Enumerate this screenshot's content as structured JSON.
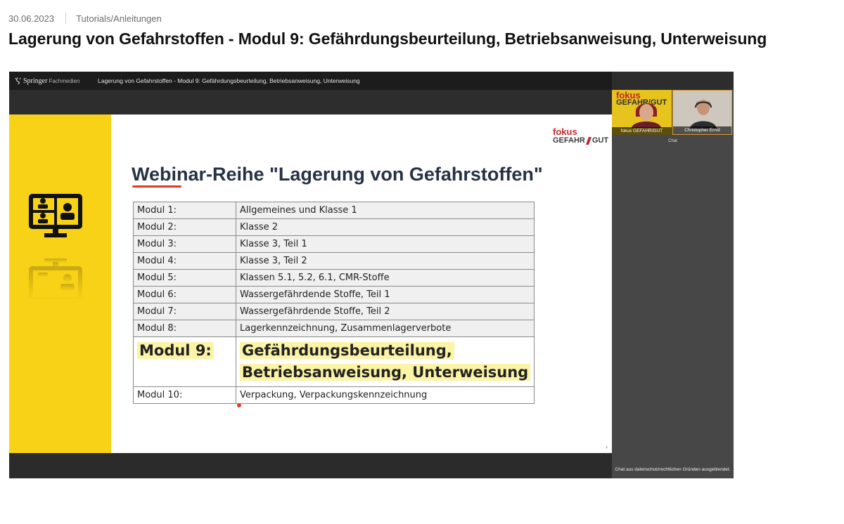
{
  "meta": {
    "date": "30.06.2023",
    "category": "Tutorials/Anleitungen"
  },
  "page_title": "Lagerung von Gefahrstoffen - Modul 9: Gefährdungsbeurteilung, Betriebsanweisung, Unterweisung",
  "player": {
    "brand": {
      "name": "Springer",
      "suffix": "Fachmedien"
    },
    "window_title": "Lagerung von Gefahrstoffen - Modul 9: Gefährdungsbeurteilung, Betriebsanweisung, Unterweisung"
  },
  "slide": {
    "logo": {
      "line1": "fokus",
      "line2a": "GEFAHR",
      "line2b": "GUT"
    },
    "heading": "Webinar-Reihe \"Lagerung von Gefahrstoffen\"",
    "modules": [
      {
        "label": "Modul 1:",
        "topic": "Allgemeines und Klasse 1"
      },
      {
        "label": "Modul 2:",
        "topic": "Klasse 2"
      },
      {
        "label": "Modul 3:",
        "topic": "Klasse 3, Teil 1"
      },
      {
        "label": "Modul 4:",
        "topic": "Klasse 3, Teil 2"
      },
      {
        "label": "Modul 5:",
        "topic": "Klassen 5.1, 5.2, 6.1, CMR-Stoffe"
      },
      {
        "label": "Modul 6:",
        "topic": "Wassergefährdende Stoffe, Teil 1"
      },
      {
        "label": "Modul 7:",
        "topic": "Wassergefährdende Stoffe, Teil 2"
      },
      {
        "label": "Modul 8:",
        "topic": "Lagerkennzeichnung, Zusammenlagerverbote"
      }
    ],
    "highlight": {
      "label": "Modul 9:",
      "topic_line1": "Gefährdungsbeurteilung,",
      "topic_line2": "Betriebsanweisung, Unterweisung"
    },
    "last": {
      "label": "Modul 10:",
      "topic": "Verpackung, Verpackungskennzeichnung"
    },
    "next_arrow": "›"
  },
  "sidebar": {
    "participants": [
      {
        "name": "fokus GEFAHR/GUT",
        "logo_line1": "fokus",
        "logo_line2": "GEFAHR/GUT"
      },
      {
        "name": "Christopher Ernst"
      }
    ],
    "chat_label": "Chat",
    "chat_notice": "Chat aus datenschutzrechtlichen Gründen ausgeblendet."
  },
  "colors": {
    "yellow": "#f8d217",
    "accent_red": "#c0272d",
    "heading": "#263244",
    "highlight": "#fbf3a6"
  }
}
